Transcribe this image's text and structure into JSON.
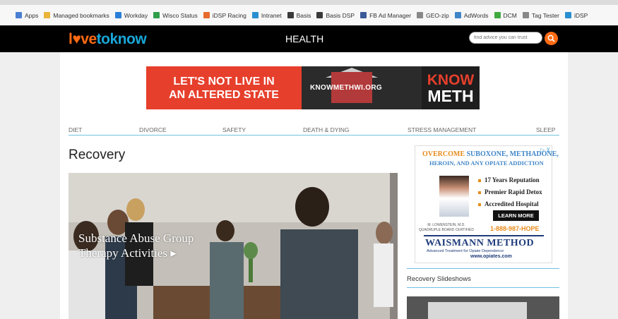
{
  "bookmarks": [
    {
      "label": "Apps",
      "icon": "apps-grid-icon",
      "color": "#4a7fd4"
    },
    {
      "label": "Managed bookmarks",
      "icon": "folder-icon",
      "color": "#e8b53a"
    },
    {
      "label": "Workday",
      "icon": "workday-icon",
      "color": "#2b7fd8"
    },
    {
      "label": "Wisco Status",
      "icon": "status-icon",
      "color": "#2f9e4a"
    },
    {
      "label": "iDSP Racing",
      "icon": "racing-icon",
      "color": "#e86a2c"
    },
    {
      "label": "Intranet",
      "icon": "intranet-icon",
      "color": "#2a8fd0"
    },
    {
      "label": "Basis",
      "icon": "basis-icon",
      "color": "#3a3a3a"
    },
    {
      "label": "Basis DSP",
      "icon": "basis-icon",
      "color": "#3a3a3a"
    },
    {
      "label": "FB Ad Manager",
      "icon": "fb-icon",
      "color": "#3a5a98"
    },
    {
      "label": "GEO-zip",
      "icon": "page-icon",
      "color": "#888888"
    },
    {
      "label": "AdWords",
      "icon": "adwords-icon",
      "color": "#3f86c8"
    },
    {
      "label": "DCM",
      "icon": "dcm-icon",
      "color": "#3faa3f"
    },
    {
      "label": "Tag Tester",
      "icon": "page-icon",
      "color": "#888888"
    },
    {
      "label": "iDSP",
      "icon": "idsp-icon",
      "color": "#2a8fd0"
    }
  ],
  "header": {
    "logo_part1": "l♥ve",
    "logo_part2": "toknow",
    "section": "HEALTH",
    "search_placeholder": "find advice you can trust"
  },
  "ad_banner": {
    "left_line1": "LET'S NOT LIVE IN",
    "left_line2": "AN ALTERED STATE",
    "url": "KNOWMETHWI.ORG",
    "right_line1": "KNOW",
    "right_line2": "METH"
  },
  "category_nav": [
    "DIET",
    "DIVORCE",
    "SAFETY",
    "DEATH & DYING",
    "STRESS MANAGEMENT",
    "SLEEP"
  ],
  "page_title": "Recovery",
  "hero": {
    "caption_line1": "Substance Abuse Group",
    "caption_line2": "Therapy Activities ▸"
  },
  "side_ad": {
    "overcome": "OVERCOME",
    "overcome_rest": "SUBOXONE, METHADONE,",
    "line2": "HEROIN, AND ANY OPIATE ADDICTION",
    "bullets": [
      "17 Years Reputation",
      "Premier Rapid Detox",
      "Accredited Hospital"
    ],
    "learn_more": "LEARN MORE",
    "doctor_line1": "M. LOWENSTEIN, M.D.",
    "doctor_line2": "QUADRUPLE BOARD CERTIFIED",
    "phone": "1-888-987-HOPE",
    "brand": "WAISMANN METHOD",
    "brand_sub": "Advanced Treatment for Opiate Dependence",
    "brand_url": "www.opiates.com",
    "adchoices": "▷ X"
  },
  "slideshows": {
    "title": "Recovery Slideshows"
  },
  "colors": {
    "logo_orange": "#ff6a13",
    "logo_blue": "#1aa6d9",
    "nav_rule": "#6fc2e0",
    "ad_red": "#e63f2c"
  }
}
